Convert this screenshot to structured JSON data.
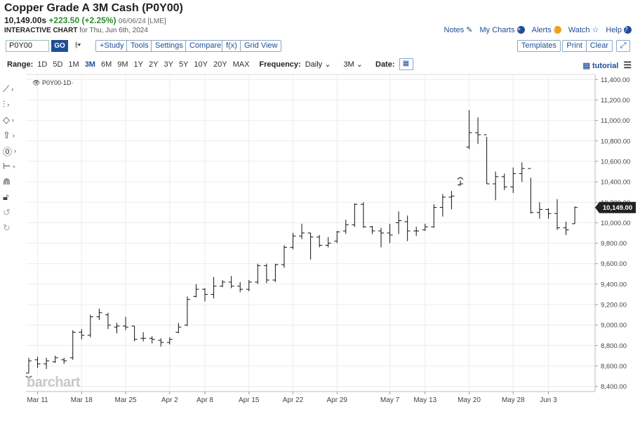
{
  "header": {
    "title": "Copper Grade A 3M Cash (P0Y00)",
    "last": "10,149.00s",
    "change": "+223.50 (+2.25%)",
    "meta": "06/06/24 [LME]",
    "chart_label": "INTERACTIVE CHART",
    "chart_date": "for Thu, Jun 6th, 2024"
  },
  "toplinks": {
    "notes": "Notes",
    "mycharts": "My Charts",
    "alerts": "Alerts",
    "watch": "Watch",
    "help": "Help"
  },
  "toolbar": {
    "symbol": "P0Y00",
    "go": "GO",
    "study": "+Study",
    "tools": "Tools",
    "settings": "Settings",
    "compare": "Compare",
    "fx": "f(x)",
    "grid_view": "Grid View",
    "templates": "Templates",
    "print": "Print",
    "clear": "Clear"
  },
  "range_bar": {
    "range_label": "Range:",
    "ranges": [
      "1D",
      "5D",
      "1M",
      "3M",
      "6M",
      "9M",
      "1Y",
      "2Y",
      "3Y",
      "5Y",
      "10Y",
      "20Y",
      "MAX"
    ],
    "selected_range": "3M",
    "frequency_label": "Frequency:",
    "frequency": "Daily",
    "period": "3M",
    "date_label": "Date:",
    "tutorial": "tutorial"
  },
  "legend": "P0Y00·1D·",
  "brand": "barchart",
  "price_badge": "10,149.00",
  "chart_data": {
    "type": "ohlc",
    "symbol": "P0Y00",
    "y_ticks": [
      8400,
      8600,
      8800,
      9000,
      9200,
      9400,
      9600,
      9800,
      10000,
      10200,
      10400,
      10600,
      10800,
      11000,
      11200,
      11400
    ],
    "y_tick_labels": [
      "8,400.00",
      "8,600.00",
      "8,800.00",
      "9,000.00",
      "9,200.00",
      "9,400.00",
      "9,600.00",
      "9,800.00",
      "10,000.00",
      "10,200.00",
      "10,400.00",
      "10,600.00",
      "10,800.00",
      "11,000.00",
      "11,200.00",
      "11,400.00"
    ],
    "ylim": [
      8350,
      11450
    ],
    "x_labels": [
      {
        "label": "Mar 11",
        "bar": 1
      },
      {
        "label": "Mar 18",
        "bar": 6
      },
      {
        "label": "Mar 25",
        "bar": 11
      },
      {
        "label": "Apr 2",
        "bar": 16
      },
      {
        "label": "Apr 8",
        "bar": 20
      },
      {
        "label": "Apr 15",
        "bar": 25
      },
      {
        "label": "Apr 22",
        "bar": 30
      },
      {
        "label": "Apr 29",
        "bar": 35
      },
      {
        "label": "May 7",
        "bar": 41
      },
      {
        "label": "May 13",
        "bar": 45
      },
      {
        "label": "May 20",
        "bar": 50
      },
      {
        "label": "May 28",
        "bar": 55
      },
      {
        "label": "Jun 3",
        "bar": 59
      }
    ],
    "low_marker_bar": 0,
    "high_marker_bar": 49,
    "bars": [
      {
        "o": 8530,
        "h": 8680,
        "l": 8530,
        "c": 8650
      },
      {
        "o": 8660,
        "h": 8690,
        "l": 8580,
        "c": 8620
      },
      {
        "o": 8620,
        "h": 8680,
        "l": 8570,
        "c": 8650
      },
      {
        "o": 8640,
        "h": 8700,
        "l": 8630,
        "c": 8680
      },
      {
        "o": 8660,
        "h": 8680,
        "l": 8620,
        "c": 8650
      },
      {
        "o": 8680,
        "h": 8950,
        "l": 8660,
        "c": 8930
      },
      {
        "o": 8930,
        "h": 8960,
        "l": 8860,
        "c": 8900
      },
      {
        "o": 8900,
        "h": 9100,
        "l": 8880,
        "c": 9080
      },
      {
        "o": 9080,
        "h": 9160,
        "l": 9050,
        "c": 9120
      },
      {
        "o": 9100,
        "h": 9120,
        "l": 8960,
        "c": 9000
      },
      {
        "o": 8980,
        "h": 9020,
        "l": 8920,
        "c": 8990
      },
      {
        "o": 8990,
        "h": 9080,
        "l": 8950,
        "c": 8980
      },
      {
        "o": 8990,
        "h": 8990,
        "l": 8840,
        "c": 8860
      },
      {
        "o": 8870,
        "h": 8930,
        "l": 8840,
        "c": 8870
      },
      {
        "o": 8870,
        "h": 8890,
        "l": 8820,
        "c": 8860
      },
      {
        "o": 8850,
        "h": 8870,
        "l": 8790,
        "c": 8830
      },
      {
        "o": 8830,
        "h": 8880,
        "l": 8810,
        "c": 8860
      },
      {
        "o": 8930,
        "h": 9020,
        "l": 8920,
        "c": 8980
      },
      {
        "o": 9000,
        "h": 9280,
        "l": 8990,
        "c": 9250
      },
      {
        "o": 9280,
        "h": 9400,
        "l": 9270,
        "c": 9350
      },
      {
        "o": 9350,
        "h": 9360,
        "l": 9230,
        "c": 9300
      },
      {
        "o": 9300,
        "h": 9470,
        "l": 9260,
        "c": 9380
      },
      {
        "o": 9380,
        "h": 9440,
        "l": 9370,
        "c": 9420
      },
      {
        "o": 9420,
        "h": 9480,
        "l": 9360,
        "c": 9380
      },
      {
        "o": 9380,
        "h": 9420,
        "l": 9320,
        "c": 9350
      },
      {
        "o": 9350,
        "h": 9440,
        "l": 9330,
        "c": 9420
      },
      {
        "o": 9420,
        "h": 9600,
        "l": 9400,
        "c": 9580
      },
      {
        "o": 9580,
        "h": 9600,
        "l": 9410,
        "c": 9440
      },
      {
        "o": 9440,
        "h": 9600,
        "l": 9420,
        "c": 9590
      },
      {
        "o": 9590,
        "h": 9780,
        "l": 9560,
        "c": 9760
      },
      {
        "o": 9760,
        "h": 9900,
        "l": 9740,
        "c": 9870
      },
      {
        "o": 9870,
        "h": 9990,
        "l": 9840,
        "c": 9900
      },
      {
        "o": 9900,
        "h": 9900,
        "l": 9640,
        "c": 9860
      },
      {
        "o": 9860,
        "h": 9880,
        "l": 9760,
        "c": 9780
      },
      {
        "o": 9780,
        "h": 9860,
        "l": 9760,
        "c": 9800
      },
      {
        "o": 9820,
        "h": 9920,
        "l": 9800,
        "c": 9910
      },
      {
        "o": 9920,
        "h": 10030,
        "l": 9890,
        "c": 9980
      },
      {
        "o": 9980,
        "h": 10190,
        "l": 9960,
        "c": 10180
      },
      {
        "o": 10180,
        "h": 10200,
        "l": 9950,
        "c": 9960
      },
      {
        "o": 9960,
        "h": 9970,
        "l": 9890,
        "c": 9920
      },
      {
        "o": 9920,
        "h": 9950,
        "l": 9760,
        "c": 9900
      },
      {
        "o": 9900,
        "h": 9990,
        "l": 9800,
        "c": 9880
      },
      {
        "o": 10000,
        "h": 10110,
        "l": 9890,
        "c": 10020
      },
      {
        "o": 10010,
        "h": 10070,
        "l": 9820,
        "c": 9920
      },
      {
        "o": 9920,
        "h": 9960,
        "l": 9870,
        "c": 9920
      },
      {
        "o": 9930,
        "h": 9990,
        "l": 9920,
        "c": 9960
      },
      {
        "o": 9960,
        "h": 10180,
        "l": 9950,
        "c": 10150
      },
      {
        "o": 10150,
        "h": 10280,
        "l": 10060,
        "c": 10250
      },
      {
        "o": 10250,
        "h": 10310,
        "l": 10130,
        "c": 10260
      },
      {
        "o": 10370,
        "h": 10410,
        "l": 10360,
        "c": 10380
      },
      {
        "o": 10740,
        "h": 11100,
        "l": 10720,
        "c": 10880
      },
      {
        "o": 10880,
        "h": 11030,
        "l": 10770,
        "c": 10860
      },
      {
        "o": 10860,
        "h": 10840,
        "l": 10380,
        "c": 10380
      },
      {
        "o": 10380,
        "h": 10500,
        "l": 10220,
        "c": 10450
      },
      {
        "o": 10450,
        "h": 10480,
        "l": 10320,
        "c": 10350
      },
      {
        "o": 10350,
        "h": 10540,
        "l": 10290,
        "c": 10480
      },
      {
        "o": 10480,
        "h": 10590,
        "l": 10400,
        "c": 10530
      },
      {
        "o": 10530,
        "h": 10440,
        "l": 10090,
        "c": 10100
      },
      {
        "o": 10100,
        "h": 10200,
        "l": 10040,
        "c": 10130
      },
      {
        "o": 10130,
        "h": 10140,
        "l": 10040,
        "c": 10090
      },
      {
        "o": 10090,
        "h": 10230,
        "l": 9930,
        "c": 9950
      },
      {
        "o": 9950,
        "h": 10010,
        "l": 9880,
        "c": 9930
      },
      {
        "o": 9990,
        "h": 10160,
        "l": 9990,
        "c": 10149
      }
    ]
  }
}
